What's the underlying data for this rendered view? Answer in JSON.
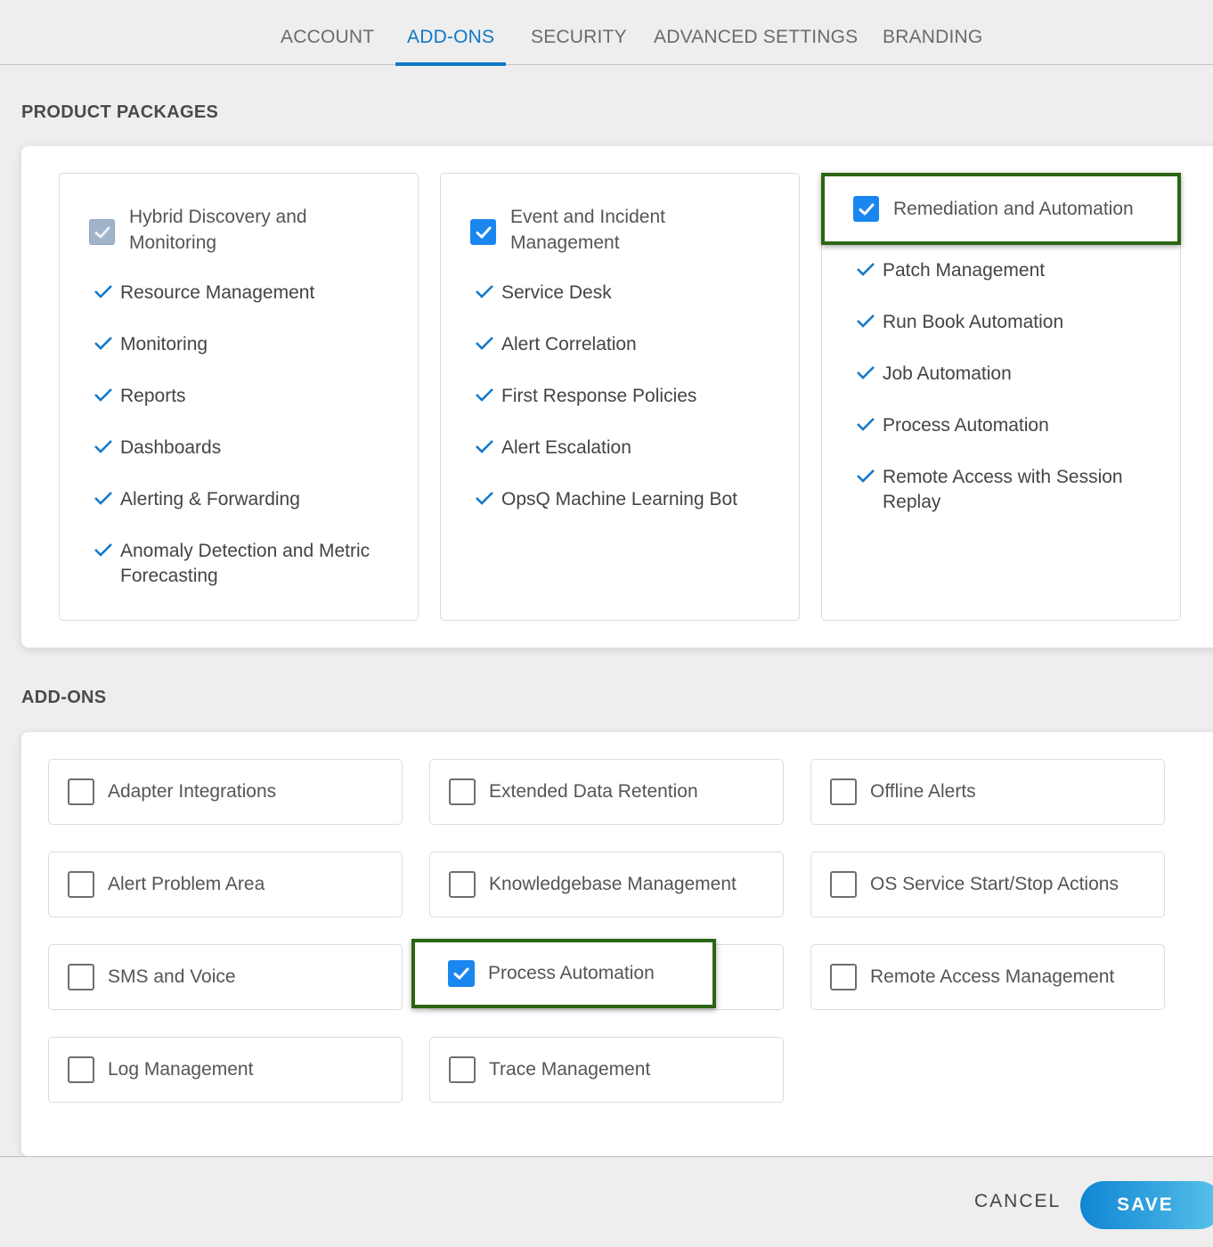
{
  "tabs": [
    {
      "label": "ACCOUNT",
      "active": false
    },
    {
      "label": "ADD-ONS",
      "active": true
    },
    {
      "label": "SECURITY",
      "active": false
    },
    {
      "label": "ADVANCED SETTINGS",
      "active": false
    },
    {
      "label": "BRANDING",
      "active": false
    }
  ],
  "product_packages": {
    "title": "PRODUCT PACKAGES",
    "packages": [
      {
        "label": "Hybrid Discovery and Monitoring",
        "state": "checked-disabled",
        "features": [
          "Resource Management",
          "Monitoring",
          "Reports",
          "Dashboards",
          "Alerting & Forwarding",
          "Anomaly Detection and Metric Forecasting"
        ]
      },
      {
        "label": "Event and Incident Management",
        "state": "checked",
        "features": [
          "Service Desk",
          "Alert Correlation",
          "First Response Policies",
          "Alert Escalation",
          "OpsQ Machine Learning Bot"
        ]
      },
      {
        "label": "Remediation and Automation",
        "state": "checked",
        "highlighted": true,
        "features": [
          "Patch Management",
          "Run Book Automation",
          "Job Automation",
          "Process Automation",
          "Remote Access with Session Replay"
        ]
      }
    ]
  },
  "addons": {
    "title": "ADD-ONS",
    "items": [
      {
        "label": "Adapter Integrations",
        "checked": false
      },
      {
        "label": "Extended Data Retention",
        "checked": false
      },
      {
        "label": "Offline Alerts",
        "checked": false
      },
      {
        "label": "Alert Problem Area",
        "checked": false
      },
      {
        "label": "Knowledgebase Management",
        "checked": false
      },
      {
        "label": "OS Service Start/Stop Actions",
        "checked": false
      },
      {
        "label": "SMS and Voice",
        "checked": false
      },
      {
        "label": "Process Automation",
        "checked": true,
        "highlighted": true
      },
      {
        "label": "Remote Access Management",
        "checked": false
      },
      {
        "label": "Log Management",
        "checked": false
      },
      {
        "label": "Trace Management",
        "checked": false
      }
    ]
  },
  "footer": {
    "cancel_label": "CANCEL",
    "save_label": "SAVE"
  },
  "colors": {
    "accent": "#0f78c8",
    "checkbox_on": "#1a86f0",
    "checkbox_disabled": "#9fb4c8",
    "highlight_border": "#2b6512"
  }
}
